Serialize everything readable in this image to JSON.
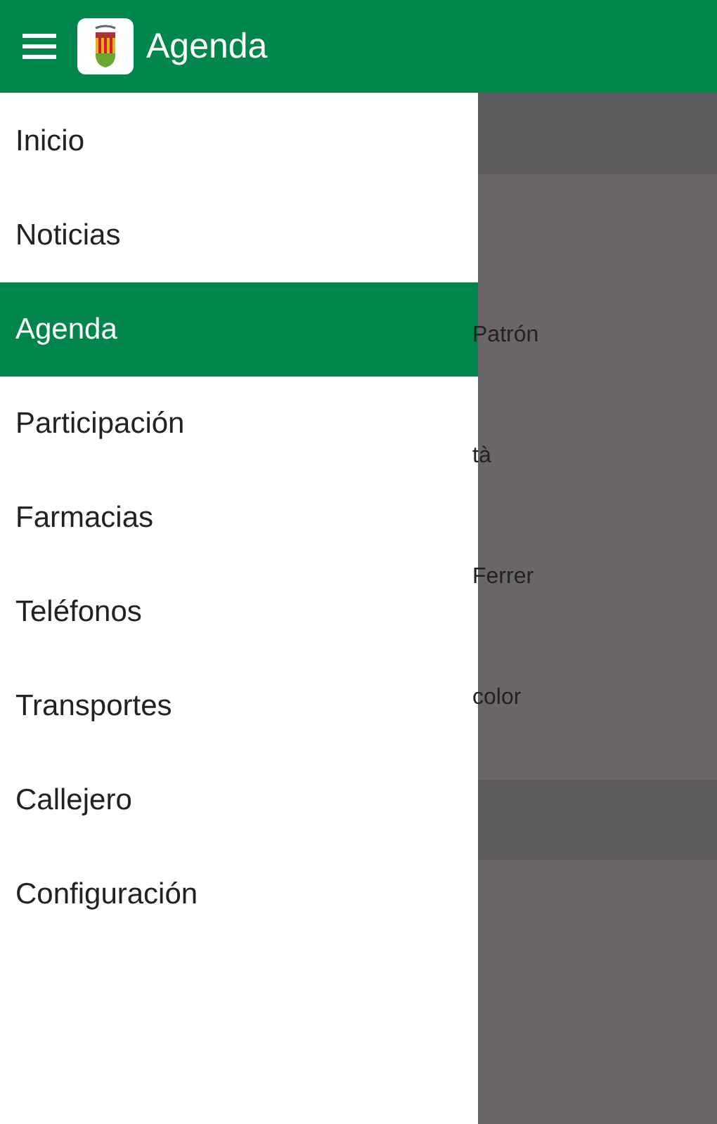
{
  "app_bar": {
    "title": "Agenda"
  },
  "drawer": {
    "items": [
      {
        "label": "Inicio",
        "selected": false
      },
      {
        "label": "Noticias",
        "selected": false
      },
      {
        "label": "Agenda",
        "selected": true
      },
      {
        "label": "Participación",
        "selected": false
      },
      {
        "label": "Farmacias",
        "selected": false
      },
      {
        "label": "Teléfonos",
        "selected": false
      },
      {
        "label": "Transportes",
        "selected": false
      },
      {
        "label": "Callejero",
        "selected": false
      },
      {
        "label": "Configuración",
        "selected": false
      }
    ]
  },
  "background_list": {
    "items": [
      "Patrón",
      "tà",
      "Ferrer",
      "color"
    ]
  }
}
